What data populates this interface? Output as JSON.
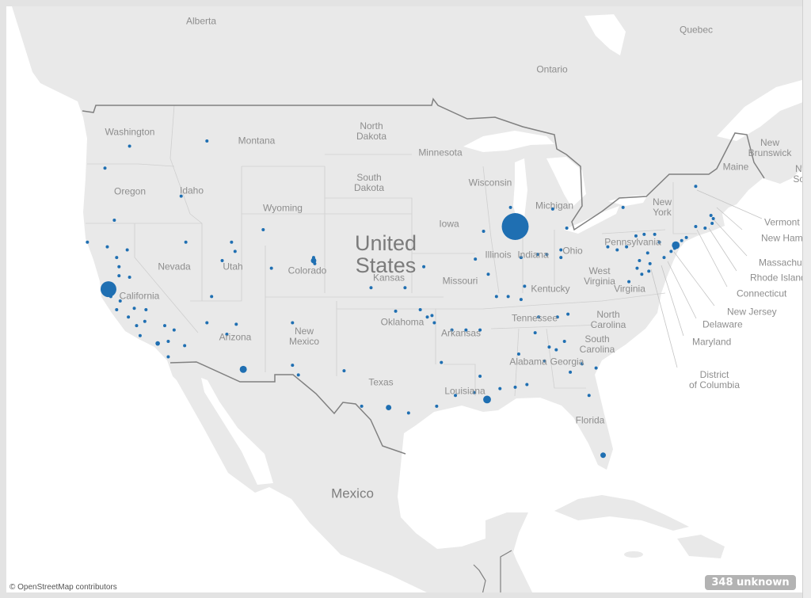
{
  "colors": {
    "land": "#e9e9e9",
    "water": "#ffffff",
    "mark": "#1f6fb2",
    "border": "#808080",
    "state_border": "#cfcfcf"
  },
  "labels": {
    "countries": {
      "united_states": "United\nStates",
      "mexico": "Mexico"
    },
    "provinces": {
      "alberta": "Alberta",
      "quebec": "Quebec",
      "ontario": "Ontario",
      "new_brunswick": "New\nBrunswick",
      "nova_scotia": "Nova\nScotia"
    },
    "states": {
      "washington": "Washington",
      "montana": "Montana",
      "north_dakota": "North\nDakota",
      "minnesota": "Minnesota",
      "oregon": "Oregon",
      "idaho": "Idaho",
      "south_dakota": "South\nDakota",
      "wisconsin": "Wisconsin",
      "michigan": "Michigan",
      "wyoming": "Wyoming",
      "iowa": "Iowa",
      "nevada": "Nevada",
      "utah": "Utah",
      "colorado": "Colorado",
      "kansas": "Kansas",
      "illinois": "Illinois",
      "indiana": "Indiana",
      "ohio": "Ohio",
      "pennsylvania": "Pennsylvania",
      "new_york": "New\nYork",
      "maine": "Maine",
      "west_virginia": "West\nVirginia",
      "virginia": "Virginia",
      "missouri": "Missouri",
      "kentucky": "Kentucky",
      "california": "California",
      "arizona": "Arizona",
      "new_mexico": "New\nMexico",
      "oklahoma": "Oklahoma",
      "arkansas": "Arkansas",
      "tennessee": "Tennessee",
      "north_carolina": "North\nCarolina",
      "south_carolina": "South\nCarolina",
      "alabama": "Alabama",
      "georgia": "Georgia",
      "texas": "Texas",
      "louisiana": "Louisiana",
      "florida": "Florida",
      "vermont": "Vermont",
      "new_hampshire": "New Hampshire",
      "massachusetts": "Massachusetts",
      "rhode_island": "Rhode Island",
      "connecticut": "Connecticut",
      "new_jersey": "New Jersey",
      "delaware": "Delaware",
      "maryland": "Maryland",
      "district_of_columbia": "District\nof Columbia"
    }
  },
  "attribution": "© OpenStreetMap contributors",
  "unknown_badge": "348 unknown",
  "points": [
    [
      -87.7,
      41.9,
      72
    ],
    [
      -122.4,
      37.8,
      25
    ],
    [
      -74.0,
      40.7,
      6
    ],
    [
      -110.9,
      32.2,
      5
    ],
    [
      -104.9,
      39.7,
      3
    ],
    [
      -90.1,
      30.0,
      6
    ],
    [
      -98.5,
      29.4,
      3
    ],
    [
      -80.2,
      25.8,
      3
    ],
    [
      -118.2,
      34.05,
      2
    ],
    [
      -122.7,
      45.5,
      1
    ],
    [
      -120.6,
      46.8,
      1
    ],
    [
      -114.0,
      47.1,
      1
    ],
    [
      -116.2,
      43.8,
      1
    ],
    [
      -121.9,
      42.3,
      1
    ],
    [
      -124.2,
      40.9,
      1
    ],
    [
      -122.5,
      40.6,
      1
    ],
    [
      -120.8,
      40.4,
      1
    ],
    [
      -121.7,
      39.9,
      1
    ],
    [
      -121.5,
      39.3,
      1
    ],
    [
      -121.5,
      38.7,
      1
    ],
    [
      -120.6,
      38.6,
      1
    ],
    [
      -115.8,
      40.9,
      1
    ],
    [
      -111.9,
      40.9,
      1
    ],
    [
      -111.6,
      40.3,
      1
    ],
    [
      -112.7,
      39.7,
      1
    ],
    [
      -108.5,
      39.2,
      1
    ],
    [
      -109.2,
      41.7,
      1
    ],
    [
      -104.9,
      39.9,
      1
    ],
    [
      -104.8,
      39.5,
      1
    ],
    [
      -113.6,
      37.3,
      1
    ],
    [
      -122.2,
      37.3,
      1
    ],
    [
      -121.4,
      37.0,
      1
    ],
    [
      -121.7,
      36.4,
      1
    ],
    [
      -120.2,
      36.5,
      1
    ],
    [
      -119.2,
      36.4,
      1
    ],
    [
      -120.7,
      35.9,
      1
    ],
    [
      -119.3,
      35.6,
      1
    ],
    [
      -120.0,
      35.3,
      1
    ],
    [
      -117.6,
      35.3,
      1
    ],
    [
      -116.8,
      35.0,
      1
    ],
    [
      -119.7,
      34.6,
      1
    ],
    [
      -117.3,
      34.2,
      1
    ],
    [
      -115.9,
      33.9,
      1
    ],
    [
      -117.3,
      33.1,
      1
    ],
    [
      -114.0,
      35.5,
      1
    ],
    [
      -111.5,
      35.4,
      1
    ],
    [
      -112.3,
      34.7,
      1
    ],
    [
      -106.7,
      35.5,
      1
    ],
    [
      -106.7,
      32.5,
      1
    ],
    [
      -106.2,
      31.8,
      1
    ],
    [
      -102.3,
      32.1,
      1
    ],
    [
      -100.8,
      29.5,
      1
    ],
    [
      -96.8,
      29.0,
      1
    ],
    [
      -100.0,
      37.9,
      1
    ],
    [
      -97.1,
      37.9,
      1
    ],
    [
      -95.5,
      39.3,
      1
    ],
    [
      -97.9,
      36.3,
      1
    ],
    [
      -95.8,
      36.4,
      1
    ],
    [
      -95.2,
      35.9,
      1
    ],
    [
      -94.8,
      36.0,
      1
    ],
    [
      -94.6,
      35.5,
      1
    ],
    [
      -94.0,
      32.7,
      1
    ],
    [
      -93.1,
      35.0,
      1
    ],
    [
      -91.9,
      35.0,
      1
    ],
    [
      -90.7,
      35.0,
      1
    ],
    [
      -94.4,
      29.5,
      1
    ],
    [
      -92.8,
      30.3,
      1
    ],
    [
      -91.2,
      30.5,
      1
    ],
    [
      -90.7,
      31.7,
      1
    ],
    [
      -89.0,
      30.8,
      1
    ],
    [
      -87.7,
      30.9,
      1
    ],
    [
      -86.7,
      31.1,
      1
    ],
    [
      -87.4,
      33.3,
      1
    ],
    [
      -85.2,
      32.8,
      1
    ],
    [
      -84.8,
      33.8,
      1
    ],
    [
      -84.2,
      33.6,
      1
    ],
    [
      -83.5,
      34.2,
      1
    ],
    [
      -82.0,
      32.6,
      1
    ],
    [
      -80.8,
      32.3,
      1
    ],
    [
      -88.1,
      43.1,
      1
    ],
    [
      -90.4,
      41.6,
      1
    ],
    [
      -91.1,
      39.8,
      1
    ],
    [
      -90.0,
      38.8,
      1
    ],
    [
      -89.3,
      37.3,
      1
    ],
    [
      -88.3,
      37.3,
      1
    ],
    [
      -86.9,
      38.0,
      1
    ],
    [
      -87.2,
      37.1,
      1
    ],
    [
      -85.8,
      40.1,
      1
    ],
    [
      -87.2,
      39.9,
      1
    ],
    [
      -85.0,
      40.1,
      1
    ],
    [
      -83.8,
      40.4,
      1
    ],
    [
      -83.8,
      39.9,
      1
    ],
    [
      -83.3,
      41.8,
      1
    ],
    [
      -84.5,
      43.0,
      1
    ],
    [
      -79.8,
      40.6,
      1
    ],
    [
      -79.0,
      40.4,
      1
    ],
    [
      -78.2,
      40.6,
      1
    ],
    [
      -77.4,
      41.3,
      1
    ],
    [
      -76.7,
      41.4,
      1
    ],
    [
      -75.8,
      41.4,
      1
    ],
    [
      -75.4,
      40.9,
      1
    ],
    [
      -76.4,
      40.2,
      1
    ],
    [
      -77.1,
      39.7,
      1
    ],
    [
      -78.0,
      38.3,
      1
    ],
    [
      -77.3,
      39.2,
      1
    ],
    [
      -76.9,
      38.8,
      1
    ],
    [
      -76.2,
      39.5,
      1
    ],
    [
      -76.3,
      39.0,
      1
    ],
    [
      -78.5,
      43.1,
      1
    ],
    [
      -72.3,
      44.4,
      1
    ],
    [
      -71.0,
      42.6,
      1
    ],
    [
      -70.8,
      42.4,
      1
    ],
    [
      -70.9,
      42.1,
      1
    ],
    [
      -71.5,
      41.8,
      1
    ],
    [
      -72.3,
      41.9,
      1
    ],
    [
      -73.1,
      41.2,
      1
    ],
    [
      -73.5,
      41.0,
      1
    ],
    [
      -74.4,
      40.3,
      1
    ],
    [
      -74.1,
      40.5,
      1
    ],
    [
      -75.0,
      39.9,
      1
    ],
    [
      -84.1,
      35.9,
      1
    ],
    [
      -83.2,
      36.1,
      1
    ],
    [
      -85.7,
      35.9,
      1
    ],
    [
      -86.0,
      34.8,
      1
    ],
    [
      -83.0,
      32.0,
      1
    ],
    [
      -81.4,
      30.3,
      1
    ]
  ]
}
